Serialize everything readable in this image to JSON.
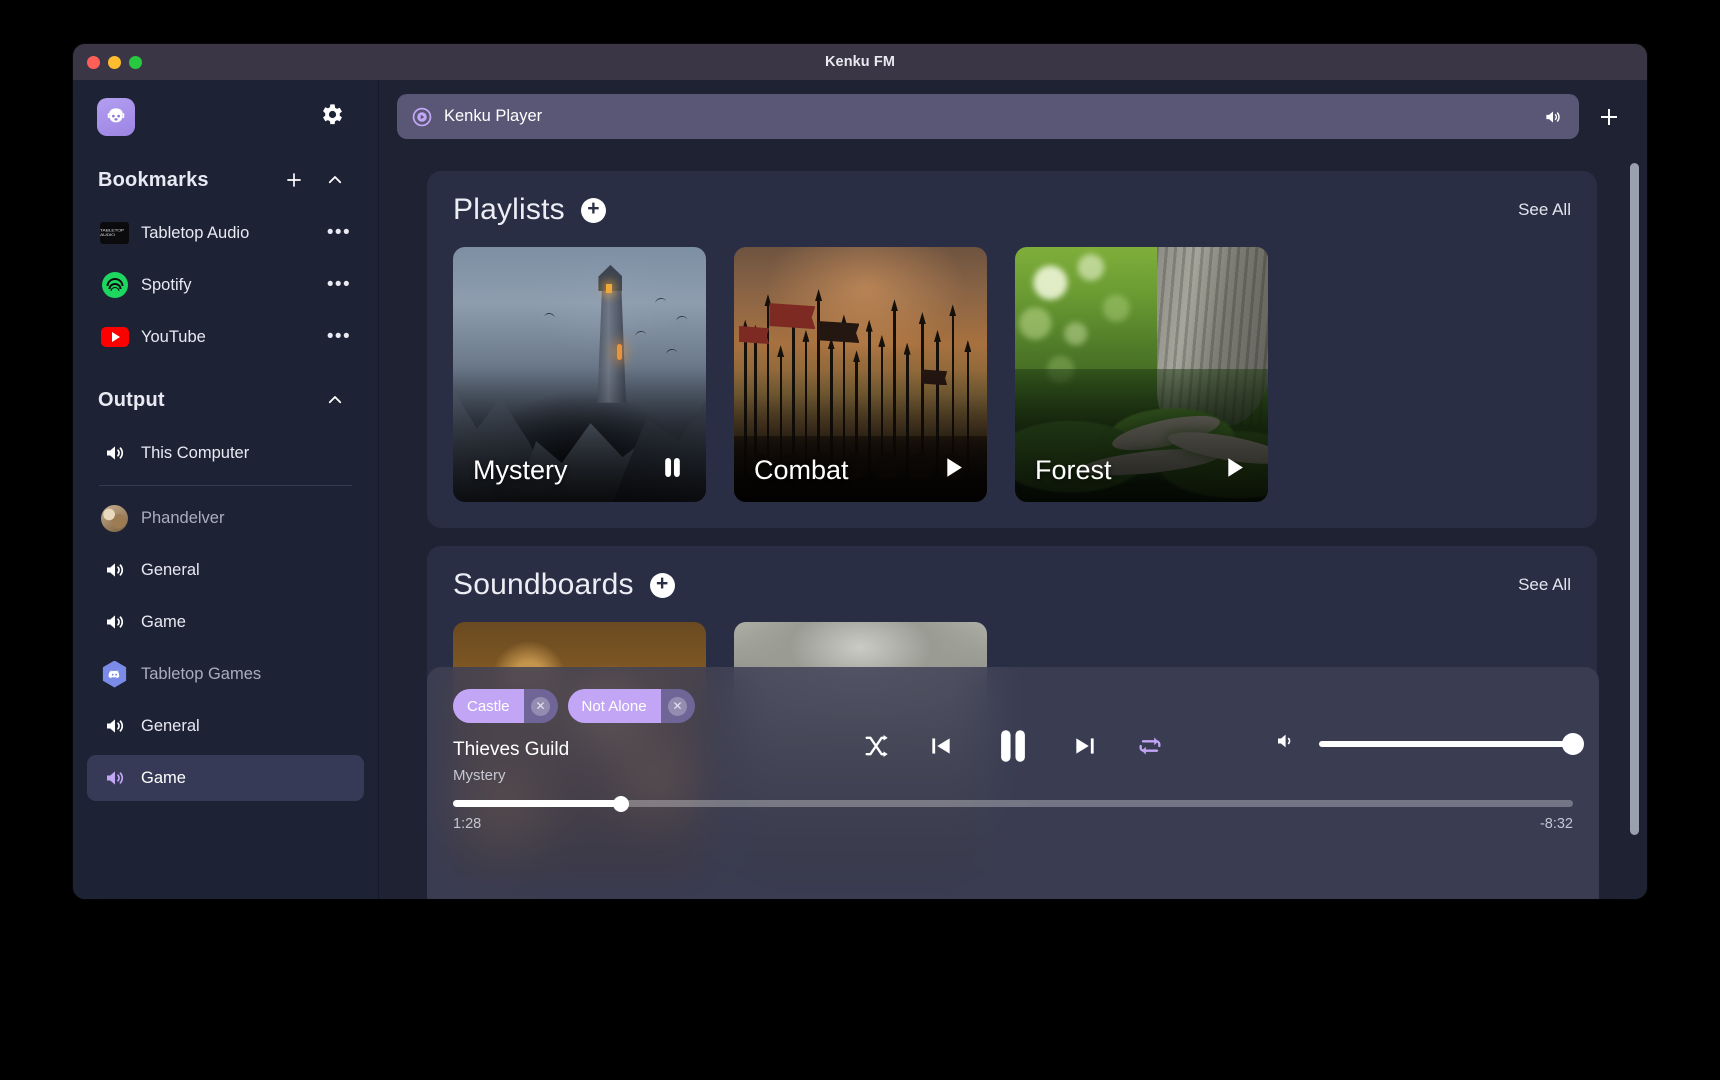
{
  "window": {
    "title": "Kenku FM",
    "traffic_lights": [
      "close-red",
      "minimize-yellow",
      "maximize-green"
    ]
  },
  "sidebar": {
    "app_logo": "kenku-bird-icon",
    "settings_icon": "gear-icon",
    "bookmarks": {
      "title": "Bookmarks",
      "add_icon": "plus-icon",
      "collapse_icon": "chevron-up-icon",
      "items": [
        {
          "label": "Tabletop Audio",
          "icon": "tabletop-audio-favicon",
          "menu": "•••"
        },
        {
          "label": "Spotify",
          "icon": "spotify-icon",
          "menu": "•••"
        },
        {
          "label": "YouTube",
          "icon": "youtube-icon",
          "menu": "•••"
        }
      ]
    },
    "output": {
      "title": "Output",
      "collapse_icon": "chevron-up-icon",
      "items": [
        {
          "label": "This Computer",
          "icon": "speaker-icon",
          "state": "normal"
        },
        {
          "label": "Phandelver",
          "icon": "avatar-icon",
          "state": "dim"
        },
        {
          "label": "General",
          "icon": "speaker-icon",
          "state": "normal"
        },
        {
          "label": "Game",
          "icon": "speaker-icon",
          "state": "normal"
        },
        {
          "label": "Tabletop Games",
          "icon": "discord-icon",
          "state": "dim"
        },
        {
          "label": "General",
          "icon": "speaker-icon",
          "state": "normal"
        },
        {
          "label": "Game",
          "icon": "speaker-icon",
          "state": "selected"
        }
      ]
    }
  },
  "topbar": {
    "tab_label": "Kenku Player",
    "tab_icon": "kenku-play-circle-icon",
    "tab_volume_icon": "speaker-icon",
    "add_tab_icon": "plus-icon"
  },
  "playlists": {
    "title": "Playlists",
    "add_icon": "plus-icon",
    "see_all": "See All",
    "cards": [
      {
        "name": "Mystery",
        "action_icon": "pause-icon",
        "art": "misty-castle-on-rocky-peak"
      },
      {
        "name": "Combat",
        "action_icon": "play-icon",
        "art": "army-spears-banners-orange-sky"
      },
      {
        "name": "Forest",
        "action_icon": "play-icon",
        "art": "mossy-tree-trunk-green-forest"
      }
    ]
  },
  "soundboards": {
    "title": "Soundboards",
    "add_icon": "plus-icon",
    "see_all": "See All",
    "cards": [
      {
        "art": "warm-golden-bokeh-lights"
      },
      {
        "art": "grey-stone-cave-texture"
      }
    ]
  },
  "player": {
    "tags": [
      {
        "label": "Castle",
        "close_icon": "close-circle-icon"
      },
      {
        "label": "Not Alone",
        "close_icon": "close-circle-icon"
      }
    ],
    "track_title": "Thieves Guild",
    "track_subtitle": "Mystery",
    "controls": {
      "shuffle": {
        "icon": "shuffle-icon",
        "active": false
      },
      "previous": {
        "icon": "previous-track-icon"
      },
      "playpause": {
        "icon": "pause-icon"
      },
      "next": {
        "icon": "next-track-icon"
      },
      "repeat": {
        "icon": "repeat-icon",
        "active": true
      }
    },
    "volume": {
      "icon": "speaker-icon",
      "level_percent": 100
    },
    "progress": {
      "elapsed": "1:28",
      "remaining": "-8:32",
      "percent": 15
    }
  },
  "colors": {
    "window_bg": "#1e2233",
    "titlebar": "#3a3646",
    "panel": "#2a2e44",
    "accent_purple": "#c2a6f5",
    "tab_bg": "#5a5776",
    "selected_row": "#373a56"
  },
  "scrollbar": {
    "name": "vertical-scrollbar"
  }
}
